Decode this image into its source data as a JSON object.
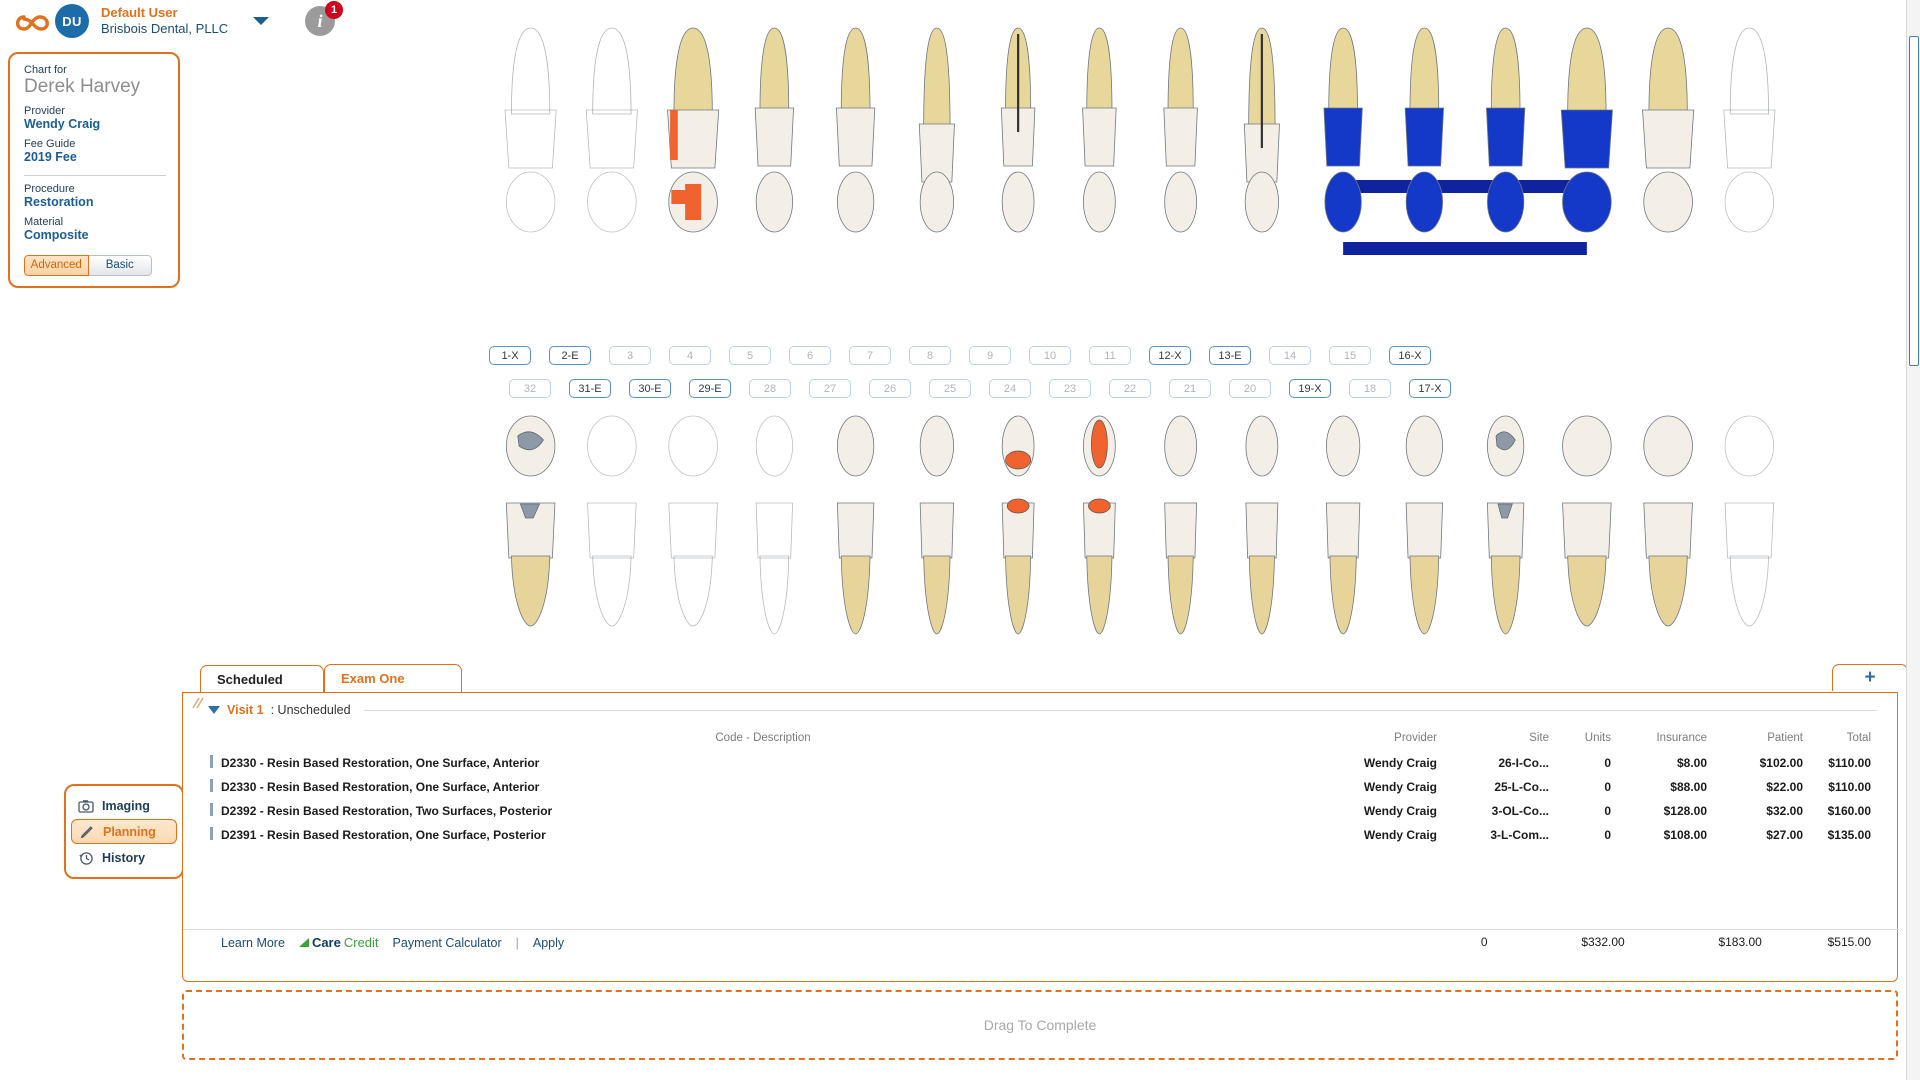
{
  "header": {
    "logo_icon": "infinity-logo",
    "avatar_initials": "DU",
    "user_name": "Default User",
    "organization": "Brisbois Dental, PLLC",
    "dropdown_icon": "chevron-down-icon",
    "info_icon": "info-icon",
    "info_badge_count": "1",
    "accent_orange": "#e2711d",
    "accent_blue": "#1b5e96"
  },
  "patient_card": {
    "chart_for_label": "Chart for",
    "patient_name": "Derek Harvey",
    "provider_label": "Provider",
    "provider_name": "Wendy Craig",
    "fee_guide_label": "Fee Guide",
    "fee_guide_value": "2019 Fee",
    "procedure_label": "Procedure",
    "procedure_value": "Restoration",
    "material_label": "Material",
    "material_value": "Composite",
    "mode_advanced": "Advanced",
    "mode_basic": "Basic",
    "mode_selected": "Advanced"
  },
  "odontogram": {
    "upper_numbers": [
      {
        "label": "1-X",
        "marked": true
      },
      {
        "label": "2-E",
        "marked": true
      },
      {
        "label": "3",
        "marked": false
      },
      {
        "label": "4",
        "marked": false
      },
      {
        "label": "5",
        "marked": false
      },
      {
        "label": "6",
        "marked": false
      },
      {
        "label": "7",
        "marked": false
      },
      {
        "label": "8",
        "marked": false
      },
      {
        "label": "9",
        "marked": false
      },
      {
        "label": "10",
        "marked": false
      },
      {
        "label": "11",
        "marked": false
      },
      {
        "label": "12-X",
        "marked": true
      },
      {
        "label": "13-E",
        "marked": true
      },
      {
        "label": "14",
        "marked": false
      },
      {
        "label": "15",
        "marked": false
      },
      {
        "label": "16-X",
        "marked": true
      }
    ],
    "lower_numbers": [
      {
        "label": "32",
        "marked": false
      },
      {
        "label": "31-E",
        "marked": true
      },
      {
        "label": "30-E",
        "marked": true
      },
      {
        "label": "29-E",
        "marked": true
      },
      {
        "label": "28",
        "marked": false
      },
      {
        "label": "27",
        "marked": false
      },
      {
        "label": "26",
        "marked": false
      },
      {
        "label": "25",
        "marked": false
      },
      {
        "label": "24",
        "marked": false
      },
      {
        "label": "23",
        "marked": false
      },
      {
        "label": "22",
        "marked": false
      },
      {
        "label": "21",
        "marked": false
      },
      {
        "label": "20",
        "marked": false
      },
      {
        "label": "19-X",
        "marked": true
      },
      {
        "label": "18",
        "marked": false
      },
      {
        "label": "17-X",
        "marked": true
      }
    ],
    "restoration_color_planned": "#f0622e",
    "restoration_color_existing": "#1438c8",
    "amalgam_color": "#8d99a6"
  },
  "left_nav": {
    "items": [
      {
        "label": "Imaging",
        "icon": "camera-icon",
        "active": false
      },
      {
        "label": "Planning",
        "icon": "pencil-icon",
        "active": true
      },
      {
        "label": "History",
        "icon": "history-icon",
        "active": false
      }
    ]
  },
  "bottom_panel": {
    "tabs": [
      {
        "label": "Scheduled",
        "active": false
      },
      {
        "label": "Exam One",
        "active": true
      }
    ],
    "add_tab_label": "+",
    "collapse_icon": "triangle-down-icon",
    "visit_title": "Visit 1",
    "visit_status": ": Unscheduled",
    "columns": {
      "code_description": "Code - Description",
      "provider": "Provider",
      "site": "Site",
      "units": "Units",
      "insurance": "Insurance",
      "patient": "Patient",
      "total": "Total"
    },
    "rows": [
      {
        "description": "D2330 - Resin Based Restoration, One Surface, Anterior",
        "provider": "Wendy Craig",
        "site": "26-I-Co...",
        "units": "0",
        "insurance": "$8.00",
        "patient": "$102.00",
        "total": "$110.00"
      },
      {
        "description": "D2330 - Resin Based Restoration, One Surface, Anterior",
        "provider": "Wendy Craig",
        "site": "25-L-Co...",
        "units": "0",
        "insurance": "$88.00",
        "patient": "$22.00",
        "total": "$110.00"
      },
      {
        "description": "D2392 - Resin Based Restoration, Two Surfaces, Posterior",
        "provider": "Wendy Craig",
        "site": "3-OL-Co...",
        "units": "0",
        "insurance": "$128.00",
        "patient": "$32.00",
        "total": "$160.00"
      },
      {
        "description": "D2391 - Resin Based Restoration, One Surface, Posterior",
        "provider": "Wendy Craig",
        "site": "3-L-Com...",
        "units": "0",
        "insurance": "$108.00",
        "patient": "$27.00",
        "total": "$135.00"
      }
    ],
    "totals": {
      "units": "0",
      "insurance": "$332.00",
      "patient": "$183.00",
      "total": "$515.00"
    },
    "footer": {
      "learn_more": "Learn More",
      "brand_care": "Care",
      "brand_credit": "Credit",
      "brand_tm": "™",
      "payment_calculator": "Payment Calculator",
      "separator": "|",
      "apply": "Apply"
    }
  },
  "dropzone": {
    "label": "Drag To Complete"
  }
}
